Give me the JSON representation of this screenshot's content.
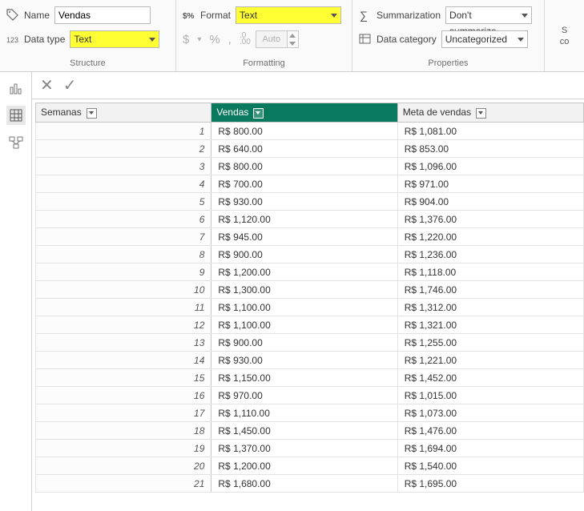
{
  "ribbon": {
    "structure": {
      "name_label": "Name",
      "name_value": "Vendas",
      "datatype_label": "Data type",
      "datatype_value": "Text",
      "title": "Structure"
    },
    "formatting": {
      "format_label": "Format",
      "format_value": "Text",
      "dollar": "$",
      "percent": "%",
      "comma": ",",
      "dec1": ".0",
      "dec2": ".00",
      "auto": "Auto",
      "title": "Formatting"
    },
    "properties": {
      "summ_label": "Summarization",
      "summ_value": "Don't summarize",
      "cat_label": "Data category",
      "cat_value": "Uncategorized",
      "title": "Properties"
    },
    "right": {
      "l1": "S",
      "l2": "co"
    }
  },
  "columns": {
    "c1": "Semanas",
    "c2": "Vendas",
    "c3": "Meta de vendas"
  },
  "rows": [
    {
      "n": "1",
      "v": "R$ 800.00",
      "m": "R$ 1,081.00"
    },
    {
      "n": "2",
      "v": "R$ 640.00",
      "m": "R$ 853.00"
    },
    {
      "n": "3",
      "v": "R$ 800.00",
      "m": "R$ 1,096.00"
    },
    {
      "n": "4",
      "v": "R$ 700.00",
      "m": "R$ 971.00"
    },
    {
      "n": "5",
      "v": "R$ 930.00",
      "m": "R$ 904.00"
    },
    {
      "n": "6",
      "v": "R$ 1,120.00",
      "m": "R$ 1,376.00"
    },
    {
      "n": "7",
      "v": "R$ 945.00",
      "m": "R$ 1,220.00"
    },
    {
      "n": "8",
      "v": "R$ 900.00",
      "m": "R$ 1,236.00"
    },
    {
      "n": "9",
      "v": "R$ 1,200.00",
      "m": "R$ 1,118.00"
    },
    {
      "n": "10",
      "v": "R$ 1,300.00",
      "m": "R$ 1,746.00"
    },
    {
      "n": "11",
      "v": "R$ 1,100.00",
      "m": "R$ 1,312.00"
    },
    {
      "n": "12",
      "v": "R$ 1,100.00",
      "m": "R$ 1,321.00"
    },
    {
      "n": "13",
      "v": "R$ 900.00",
      "m": "R$ 1,255.00"
    },
    {
      "n": "14",
      "v": "R$ 930.00",
      "m": "R$ 1,221.00"
    },
    {
      "n": "15",
      "v": "R$ 1,150.00",
      "m": "R$ 1,452.00"
    },
    {
      "n": "16",
      "v": "R$ 970.00",
      "m": "R$ 1,015.00"
    },
    {
      "n": "17",
      "v": "R$ 1,110.00",
      "m": "R$ 1,073.00"
    },
    {
      "n": "18",
      "v": "R$ 1,450.00",
      "m": "R$ 1,476.00"
    },
    {
      "n": "19",
      "v": "R$ 1,370.00",
      "m": "R$ 1,694.00"
    },
    {
      "n": "20",
      "v": "R$ 1,200.00",
      "m": "R$ 1,540.00"
    },
    {
      "n": "21",
      "v": "R$ 1,680.00",
      "m": "R$ 1,695.00"
    }
  ]
}
